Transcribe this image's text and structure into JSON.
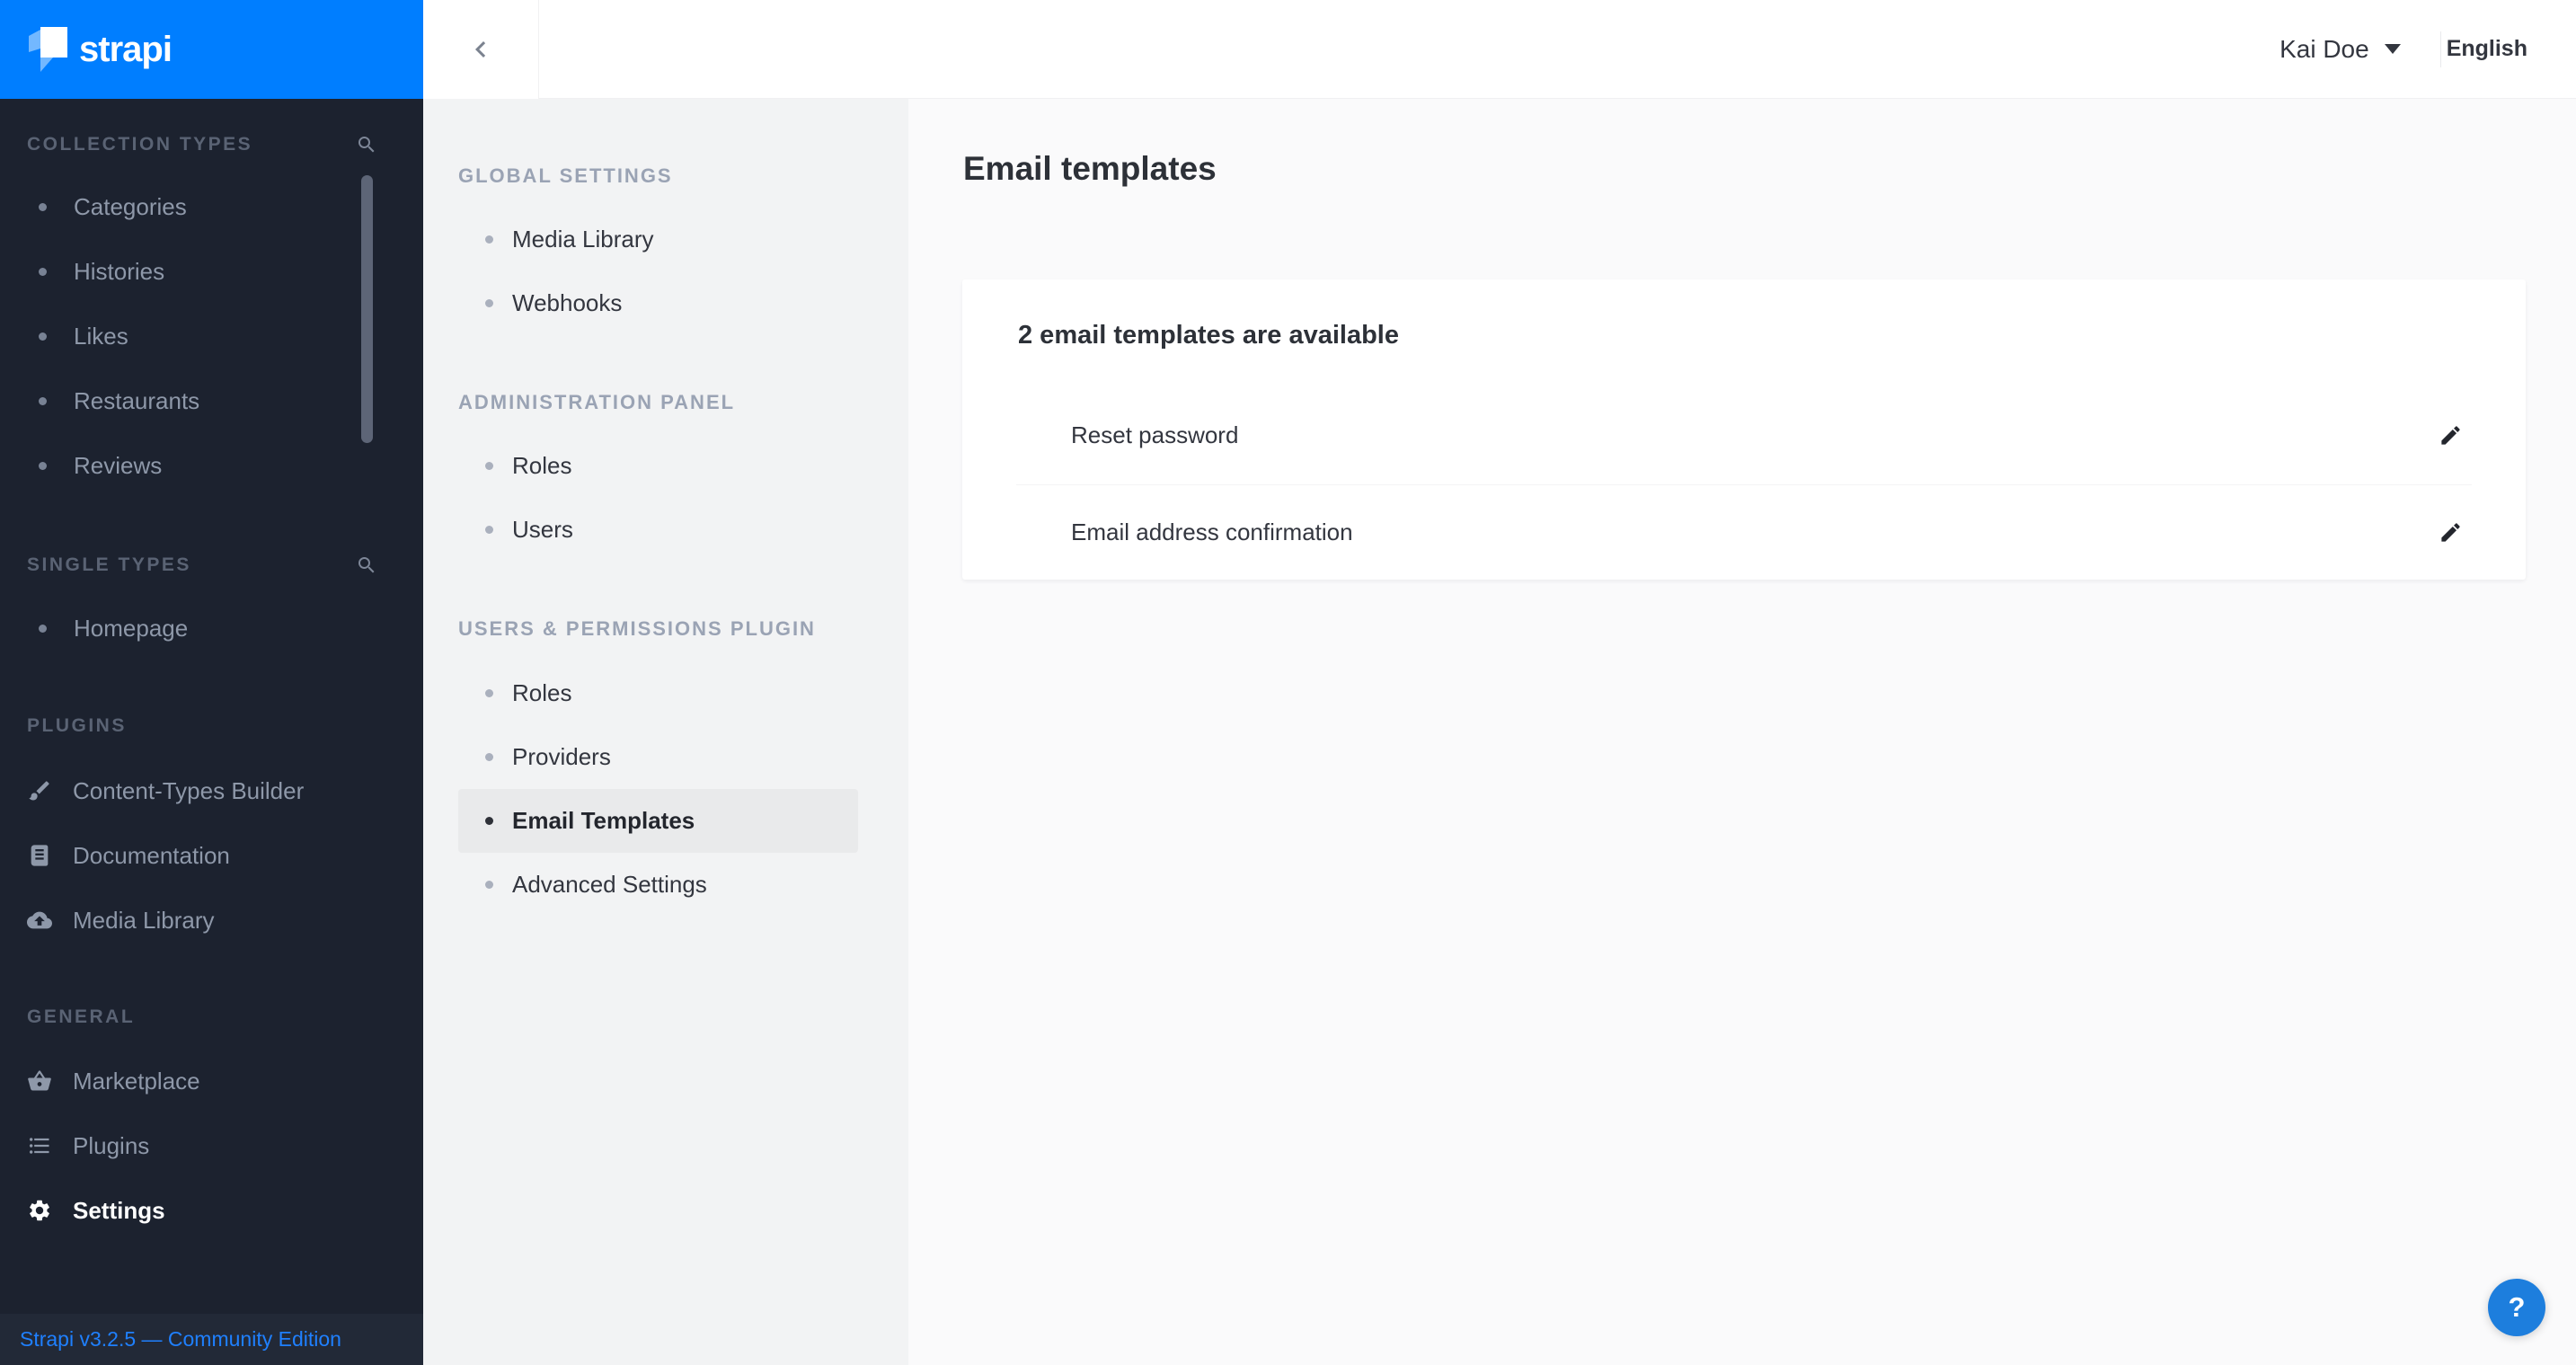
{
  "colors": {
    "brand_blue": "#007eff",
    "sidebar_bg": "#1c222f",
    "sidebar_footer_bg": "#222937",
    "footer_link": "#1f80ff",
    "settings_nav_bg": "#f2f3f4",
    "active_item_bg": "#e9eaeb",
    "main_bg": "#fafafb",
    "card_bg": "#ffffff",
    "help_button_bg": "#1d7edd",
    "text_dark": "#33363f",
    "text_muted": "#8e98a9"
  },
  "left_sidebar": {
    "logo_text": "strapi",
    "sections": [
      {
        "title": "COLLECTION TYPES",
        "items": [
          {
            "label": "Categories"
          },
          {
            "label": "Histories"
          },
          {
            "label": "Likes"
          },
          {
            "label": "Restaurants"
          },
          {
            "label": "Reviews"
          }
        ]
      },
      {
        "title": "SINGLE TYPES",
        "items": [
          {
            "label": "Homepage"
          }
        ]
      },
      {
        "title": "PLUGINS",
        "items": [
          {
            "label": "Content-Types Builder"
          },
          {
            "label": "Documentation"
          },
          {
            "label": "Media Library"
          }
        ]
      },
      {
        "title": "GENERAL",
        "items": [
          {
            "label": "Marketplace"
          },
          {
            "label": "Plugins"
          },
          {
            "label": "Settings"
          }
        ]
      }
    ],
    "footer_text": "Strapi v3.2.5 — Community Edition"
  },
  "topbar": {
    "user_name": "Kai Doe",
    "locale": "English"
  },
  "settings_nav": {
    "sections": [
      {
        "title": "GLOBAL SETTINGS",
        "items": [
          {
            "label": "Media Library"
          },
          {
            "label": "Webhooks"
          }
        ]
      },
      {
        "title": "ADMINISTRATION PANEL",
        "items": [
          {
            "label": "Roles"
          },
          {
            "label": "Users"
          }
        ]
      },
      {
        "title": "USERS & PERMISSIONS PLUGIN",
        "items": [
          {
            "label": "Roles"
          },
          {
            "label": "Providers"
          },
          {
            "label": "Email Templates",
            "active": true
          },
          {
            "label": "Advanced Settings"
          }
        ]
      }
    ]
  },
  "main": {
    "page_title": "Email templates",
    "card_title": "2 email templates are available",
    "templates": [
      {
        "label": "Reset password"
      },
      {
        "label": "Email address confirmation"
      }
    ]
  },
  "help_button_label": "?"
}
